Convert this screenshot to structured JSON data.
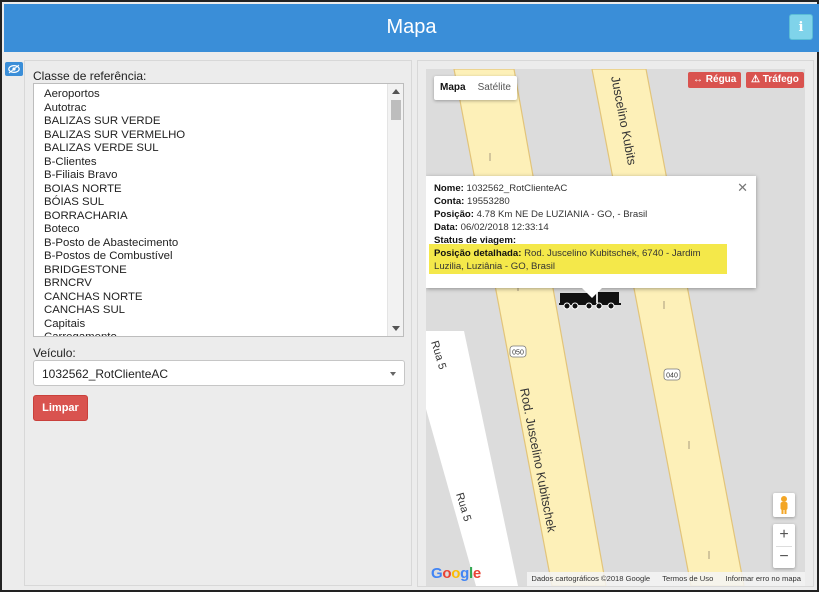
{
  "header": {
    "title": "Mapa",
    "info_icon": "info-icon"
  },
  "side_toggle": {
    "icon": "eye-icon"
  },
  "filters": {
    "reference_label": "Classe de referência:",
    "reference_items": [
      "Aeroportos",
      "Autotrac",
      "BALIZAS SUR VERDE",
      "BALIZAS SUR VERMELHO",
      "BALIZAS VERDE SUL",
      "B-Clientes",
      "B-Filiais Bravo",
      "BOIAS NORTE",
      "BÓIAS SUL",
      "BORRACHARIA",
      "Boteco",
      "B-Posto de Abastecimento",
      "B-Postos de Combustível",
      "BRIDGESTONE",
      "BRNCRV",
      "CANCHAS NORTE",
      "CANCHAS SUL",
      "Capitais",
      "Carregamento"
    ],
    "vehicle_label": "Veículo:",
    "vehicle_value": "1032562_RotClienteAC",
    "clear_button": "Limpar"
  },
  "map": {
    "type_buttons": {
      "map": "Mapa",
      "satellite": "Satélite"
    },
    "ruler_button": "Régua",
    "traffic_button": "Tráfego",
    "roads": {
      "main_road": "Rod. Juscelino Kubitschek",
      "main_road_top": "Juscelino Kubits",
      "side_street": "Rua 5",
      "side_street_top": "Rua 5",
      "shield_1": "050",
      "shield_2": "040"
    },
    "popup": {
      "name_label": "Nome:",
      "name_value": "1032562_RotClienteAC",
      "account_label": "Conta:",
      "account_value": "19553280",
      "position_label": "Posição:",
      "position_value": "4.78 Km NE De LUZIANIA - GO, - Brasil",
      "date_label": "Data:",
      "date_value": "06/02/2018 12:33:14",
      "trip_status_label": "Status de viagem:",
      "trip_status_value": "",
      "detailed_label": "Posição detalhada:",
      "detailed_value_line1": "Rod. Juscelino Kubitschek, 6740 - Jardim",
      "detailed_value_line2": "Luzilia, Luziânia - GO, Brasil"
    },
    "zoom_in": "+",
    "zoom_out": "−",
    "google_logo": "Google",
    "attribution": {
      "data": "Dados cartográficos ©2018 Google",
      "terms": "Termos de Uso",
      "report": "Informar erro no mapa"
    },
    "colors": {
      "road_fill": "#fdf0b8",
      "road_edge": "#e2c47a",
      "highlight": "#f4e84a",
      "button_red": "#d9534f",
      "header_blue": "#3a8ed8"
    }
  }
}
